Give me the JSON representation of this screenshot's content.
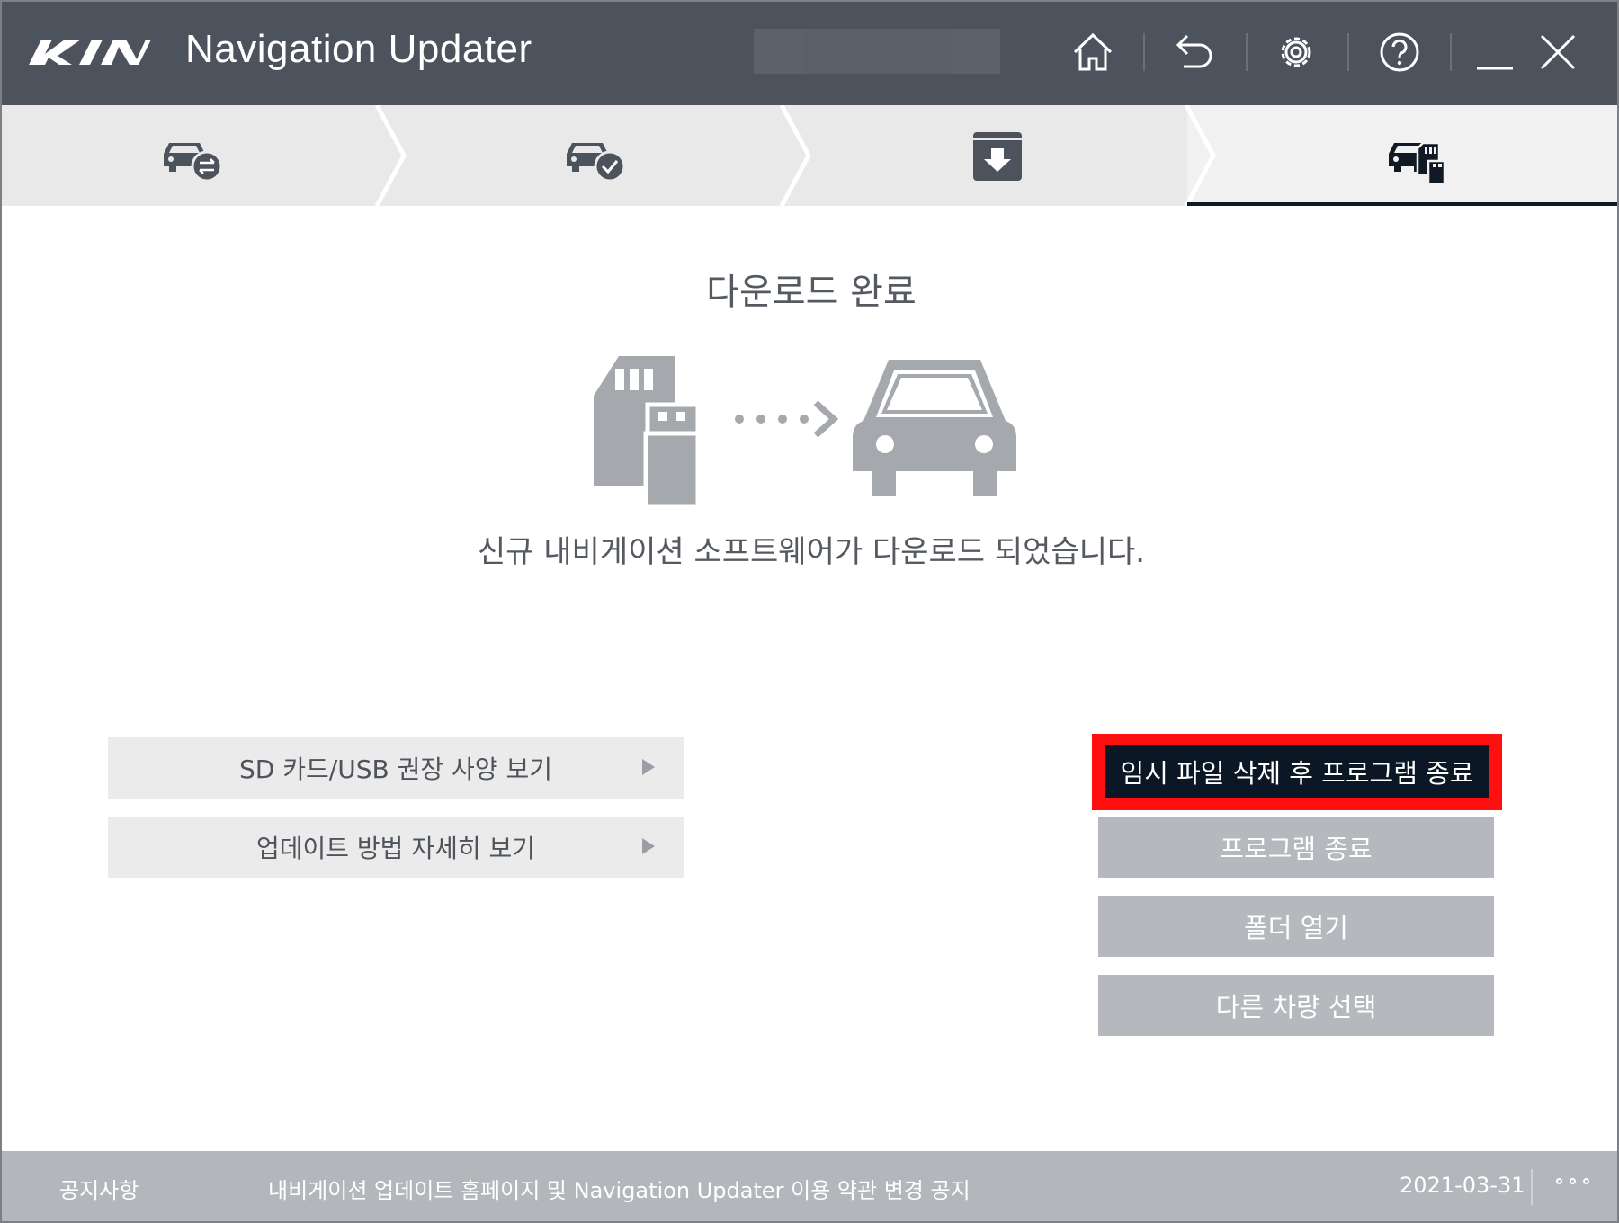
{
  "header": {
    "brand": "KIA",
    "title": "Navigation Updater",
    "buttons": {
      "home": "home-icon",
      "back": "undo-icon",
      "settings": "gear-icon",
      "help": "help-icon",
      "minimize": "minimize-icon",
      "close": "close-icon"
    }
  },
  "steps": [
    {
      "icon": "car-exchange-icon",
      "active": false
    },
    {
      "icon": "car-check-icon",
      "active": false
    },
    {
      "icon": "download-box-icon",
      "active": false
    },
    {
      "icon": "car-sd-card-icon",
      "active": true
    }
  ],
  "main": {
    "title": "다운로드 완료",
    "message": "신규 내비게이션 소프트웨어가 다운로드 되었습니다."
  },
  "links": {
    "sd_usb": "SD 카드/USB 권장 사양 보기",
    "how_to": "업데이트 방법 자세히 보기"
  },
  "actions": {
    "delete_and_exit": "임시 파일 삭제 후 프로그램 종료",
    "exit": "프로그램 종료",
    "open_folder": "폴더 열기",
    "select_other_vehicle": "다른 차량 선택"
  },
  "footer": {
    "notice_label": "공지사항",
    "notice_text": "내비게이션 업데이트 홈페이지 및 Navigation Updater 이용 약관 변경 공지",
    "date": "2021-03-31"
  },
  "colors": {
    "header_bg": "#4d535c",
    "primary": "#0b1724",
    "highlight": "#ff1010",
    "secondary_btn": "#b5b8bc"
  }
}
